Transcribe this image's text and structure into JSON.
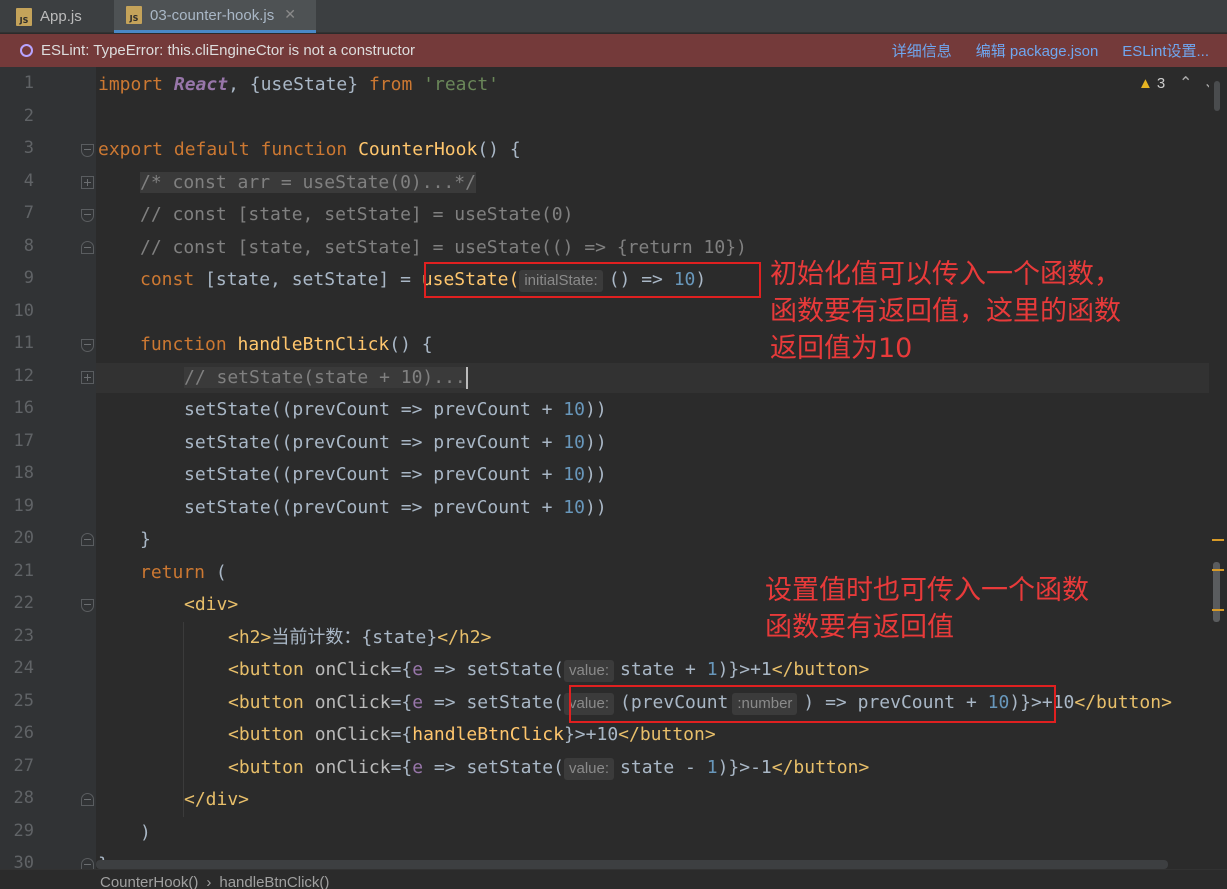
{
  "tabs": [
    {
      "label": "App.js",
      "icon": "js-file-icon"
    },
    {
      "label": "03-counter-hook.js",
      "icon": "js-file-icon"
    }
  ],
  "eslint_banner": {
    "message": "ESLint: TypeError: this.cliEngineCtor is not a constructor",
    "links": [
      "详细信息",
      "编辑 package.json",
      "ESLint设置..."
    ]
  },
  "inspections": {
    "warning_count": "3"
  },
  "line_numbers": [
    "1",
    "2",
    "3",
    "4",
    "7",
    "8",
    "9",
    "10",
    "11",
    "12",
    "16",
    "17",
    "18",
    "19",
    "20",
    "21",
    "22",
    "23",
    "24",
    "25",
    "26",
    "27",
    "28",
    "29",
    "30"
  ],
  "code": {
    "l1_import": "import",
    "l1_react": "React",
    "l1_mid": ", {useState} ",
    "l1_from": "from",
    "l1_str": "'react'",
    "l3_kw": "export default function",
    "l3_name": "CounterHook",
    "l3_rest": "() {",
    "l4": "/* const arr = useState(0)...*/",
    "l7": "// const [state, setState] = useState(0)",
    "l8": "// const [state, setState] = useState(() => {return 10})",
    "l9_kw": "const",
    "l9_mid": " [state, setState] = ",
    "l9_call": "useState(",
    "l9_hint": "initialState:",
    "l9_arrow": "() => ",
    "l9_num": "10",
    "l9_end": ")",
    "l11_kw": "function",
    "l11_name": "handleBtnClick",
    "l11_rest": "() {",
    "l12": "// setState(state + 10)...",
    "set_a": "setState((prevCount => prevCount + ",
    "set_num": "10",
    "set_b": "))",
    "l20": "}",
    "l21_kw": "return",
    "l21_rest": " (",
    "l22_tag": "<div>",
    "l23_open": "<h2>",
    "l23_text": "当前计数：{state}",
    "l23_close": "</h2>",
    "btn_open": "<button ",
    "onclick": "onClick",
    "eq_brace": "={",
    "e_param": "e",
    "arrow_set": " => setState(",
    "hint_value": "value:",
    "l24_expr": "state + ",
    "l24_num": "1",
    "l24_tail": ")}>+1",
    "btn_close": "</button>",
    "l25_prev": "(prevCount",
    "hint_number": ":number",
    "l25_mid": ") => prevCount + ",
    "l25_num": "10",
    "l25_tail": ")}>+10",
    "l26_handler": "handleBtnClick",
    "l26_tail": "}>+10",
    "l27_expr": "state - ",
    "l27_num": "1",
    "l27_tail": ")}>-1",
    "l28_tag": "</div>",
    "l29": ")",
    "l30": "}"
  },
  "annotations": {
    "a1_line1": "初始化值可以传入一个函数，",
    "a1_line2": "函数要有返回值，这里的函数",
    "a1_line3": "返回值为10",
    "a2_line1": "设置值时也可传入一个函数",
    "a2_line2": "函数要有返回值"
  },
  "breadcrumbs": [
    "CounterHook()",
    "handleBtnClick()"
  ],
  "colors": {
    "annotation": "#e83a3a",
    "banner": "#743a3a",
    "keyword": "#cc7832",
    "function": "#ffc66d"
  }
}
